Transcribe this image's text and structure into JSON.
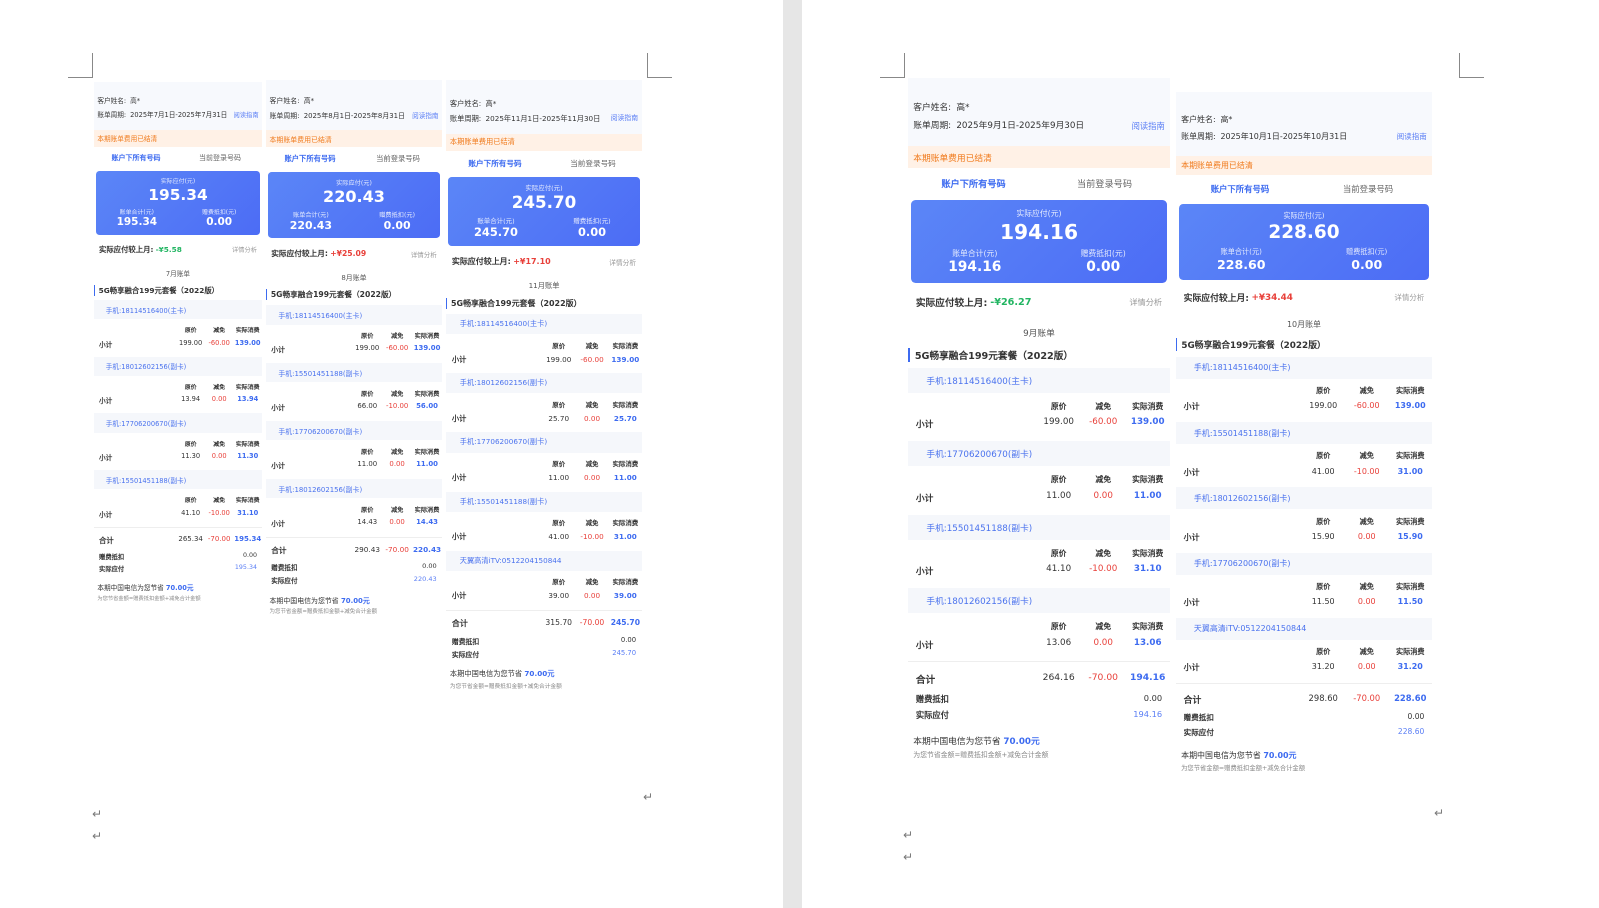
{
  "common": {
    "customer_label": "客户姓名:",
    "customer_name": "高*",
    "period_label": "账单周期:",
    "guide": "阅读指南",
    "notice": "本期账单费用已结清",
    "tab_all": "账户下所有号码",
    "tab_current": "当前登录号码",
    "payable_label": "实际应付(元)",
    "bill_total_label": "账单合计(元)",
    "gift_label": "赠费抵扣(元)",
    "compare_label": "实际应付较上月:",
    "detail": "详情分析",
    "plan": "5G畅享融合199元套餐（2022版）",
    "col_orig": "原价",
    "col_disc": "减免",
    "col_actual": "实际消费",
    "subtotal": "小计",
    "total": "合计",
    "gift_row": "赠费抵扣",
    "payable_row": "实际应付",
    "save_prefix": "本期中国电信为您节省",
    "save_amount": "70.00元",
    "formula": "为您节省金额=赠费抵扣金额+减免合计金额",
    "return_mark": "↵"
  },
  "bills": [
    {
      "period": "2025年7月1日-2025年7月31日",
      "payable": "195.34",
      "bill_total": "195.34",
      "gift": "0.00",
      "delta": "-¥5.58",
      "delta_dir": "down",
      "month": "7月账单",
      "lines": [
        {
          "phone": "手机:18114516400(主卡)",
          "orig": "199.00",
          "disc": "-60.00",
          "actual": "139.00"
        },
        {
          "phone": "手机:18012602156(副卡)",
          "orig": "13.94",
          "disc": "0.00",
          "actual": "13.94"
        },
        {
          "phone": "手机:17706200670(副卡)",
          "orig": "11.30",
          "disc": "0.00",
          "actual": "11.30"
        },
        {
          "phone": "手机:15501451188(副卡)",
          "orig": "41.10",
          "disc": "-10.00",
          "actual": "31.10"
        }
      ],
      "total": {
        "orig": "265.34",
        "disc": "-70.00",
        "actual": "195.34"
      },
      "gift_value": "0.00",
      "payable_value": "195.34"
    },
    {
      "period": "2025年8月1日-2025年8月31日",
      "payable": "220.43",
      "bill_total": "220.43",
      "gift": "0.00",
      "delta": "+¥25.09",
      "delta_dir": "up",
      "month": "8月账单",
      "lines": [
        {
          "phone": "手机:18114516400(主卡)",
          "orig": "199.00",
          "disc": "-60.00",
          "actual": "139.00"
        },
        {
          "phone": "手机:15501451188(副卡)",
          "orig": "66.00",
          "disc": "-10.00",
          "actual": "56.00"
        },
        {
          "phone": "手机:17706200670(副卡)",
          "orig": "11.00",
          "disc": "0.00",
          "actual": "11.00"
        },
        {
          "phone": "手机:18012602156(副卡)",
          "orig": "14.43",
          "disc": "0.00",
          "actual": "14.43"
        }
      ],
      "total": {
        "orig": "290.43",
        "disc": "-70.00",
        "actual": "220.43"
      },
      "gift_value": "0.00",
      "payable_value": "220.43"
    },
    {
      "period": "2025年11月1日-2025年11月30日",
      "payable": "245.70",
      "bill_total": "245.70",
      "gift": "0.00",
      "delta": "+¥17.10",
      "delta_dir": "up",
      "month": "11月账单",
      "lines": [
        {
          "phone": "手机:18114516400(主卡)",
          "orig": "199.00",
          "disc": "-60.00",
          "actual": "139.00"
        },
        {
          "phone": "手机:18012602156(副卡)",
          "orig": "25.70",
          "disc": "0.00",
          "actual": "25.70"
        },
        {
          "phone": "手机:17706200670(副卡)",
          "orig": "11.00",
          "disc": "0.00",
          "actual": "11.00"
        },
        {
          "phone": "手机:15501451188(副卡)",
          "orig": "41.00",
          "disc": "-10.00",
          "actual": "31.00"
        },
        {
          "phone": "天翼高清iTV:0512204150844",
          "orig": "39.00",
          "disc": "0.00",
          "actual": "39.00"
        }
      ],
      "total": {
        "orig": "315.70",
        "disc": "-70.00",
        "actual": "245.70"
      },
      "gift_value": "0.00",
      "payable_value": "245.70"
    },
    {
      "period": "2025年9月1日-2025年9月30日",
      "payable": "194.16",
      "bill_total": "194.16",
      "gift": "0.00",
      "delta": "-¥26.27",
      "delta_dir": "down",
      "month": "9月账单",
      "lines": [
        {
          "phone": "手机:18114516400(主卡)",
          "orig": "199.00",
          "disc": "-60.00",
          "actual": "139.00"
        },
        {
          "phone": "手机:17706200670(副卡)",
          "orig": "11.00",
          "disc": "0.00",
          "actual": "11.00"
        },
        {
          "phone": "手机:15501451188(副卡)",
          "orig": "41.10",
          "disc": "-10.00",
          "actual": "31.10"
        },
        {
          "phone": "手机:18012602156(副卡)",
          "orig": "13.06",
          "disc": "0.00",
          "actual": "13.06"
        }
      ],
      "total": {
        "orig": "264.16",
        "disc": "-70.00",
        "actual": "194.16"
      },
      "gift_value": "0.00",
      "payable_value": "194.16"
    },
    {
      "period": "2025年10月1日-2025年10月31日",
      "payable": "228.60",
      "bill_total": "228.60",
      "gift": "0.00",
      "delta": "+¥34.44",
      "delta_dir": "up",
      "month": "10月账单",
      "lines": [
        {
          "phone": "手机:18114516400(主卡)",
          "orig": "199.00",
          "disc": "-60.00",
          "actual": "139.00"
        },
        {
          "phone": "手机:15501451188(副卡)",
          "orig": "41.00",
          "disc": "-10.00",
          "actual": "31.00"
        },
        {
          "phone": "手机:18012602156(副卡)",
          "orig": "15.90",
          "disc": "0.00",
          "actual": "15.90"
        },
        {
          "phone": "手机:17706200670(副卡)",
          "orig": "11.50",
          "disc": "0.00",
          "actual": "11.50"
        },
        {
          "phone": "天翼高清iTV:0512204150844",
          "orig": "31.20",
          "disc": "0.00",
          "actual": "31.20"
        }
      ],
      "total": {
        "orig": "298.60",
        "disc": "-70.00",
        "actual": "228.60"
      },
      "gift_value": "0.00",
      "payable_value": "228.60"
    }
  ]
}
